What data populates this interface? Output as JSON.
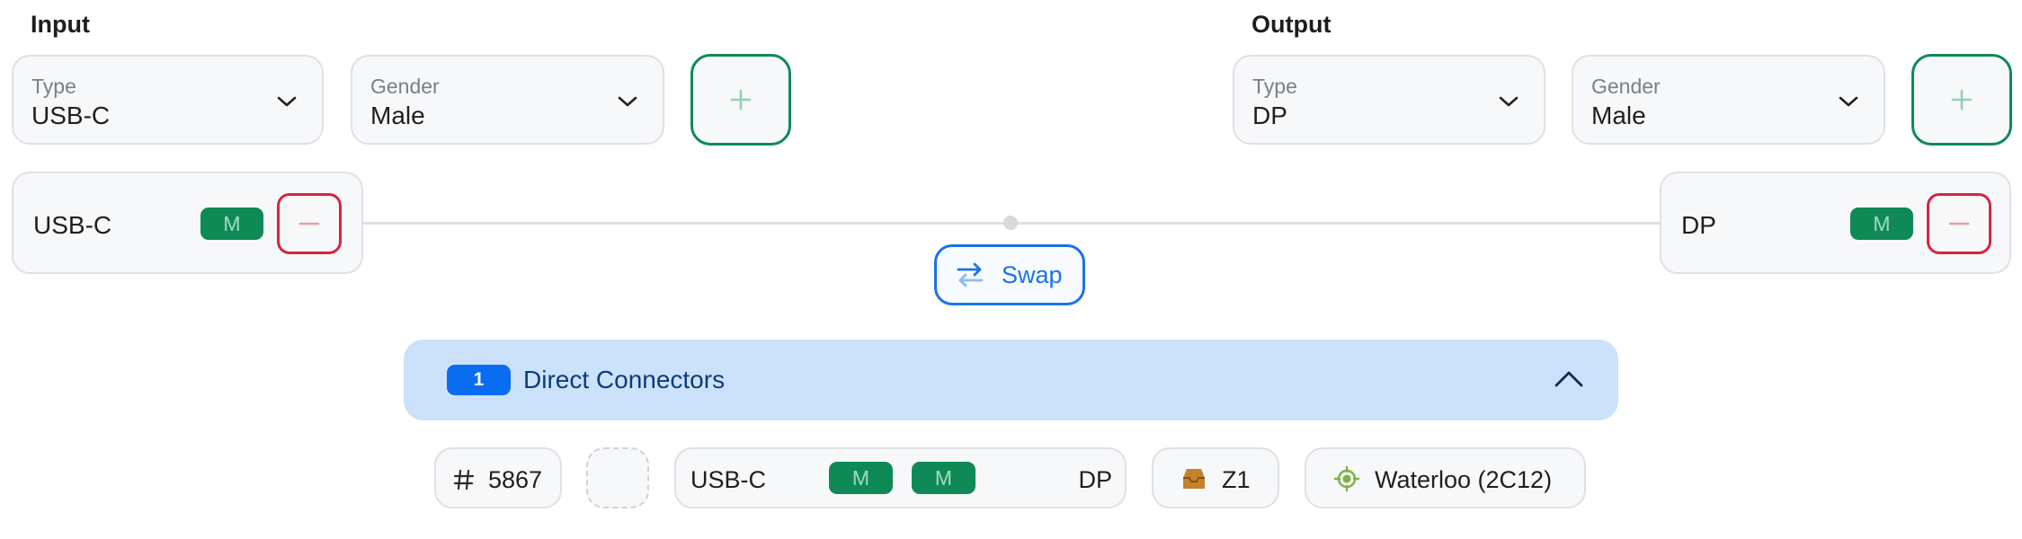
{
  "input": {
    "title": "Input",
    "type": {
      "label": "Type",
      "value": "USB-C"
    },
    "gender": {
      "label": "Gender",
      "value": "Male"
    },
    "add_label": "+",
    "connector": {
      "name": "USB-C",
      "gender_badge": "M",
      "remove_label": "−"
    }
  },
  "output": {
    "title": "Output",
    "type": {
      "label": "Type",
      "value": "DP"
    },
    "gender": {
      "label": "Gender",
      "value": "Male"
    },
    "add_label": "+",
    "connector": {
      "name": "DP",
      "gender_badge": "M",
      "remove_label": "−"
    }
  },
  "swap": {
    "label": "Swap"
  },
  "results": {
    "count": "1",
    "title": "Direct Connectors",
    "item": {
      "id": "5867",
      "from": "USB-C",
      "from_gender": "M",
      "to_gender": "M",
      "to": "DP",
      "bin": "Z1",
      "location": "Waterloo (2C12)"
    }
  },
  "colors": {
    "accent_green": "#0f8a57",
    "accent_blue": "#1a73e8",
    "danger_red": "#d8243f",
    "panel_blue": "#cce2fb"
  }
}
